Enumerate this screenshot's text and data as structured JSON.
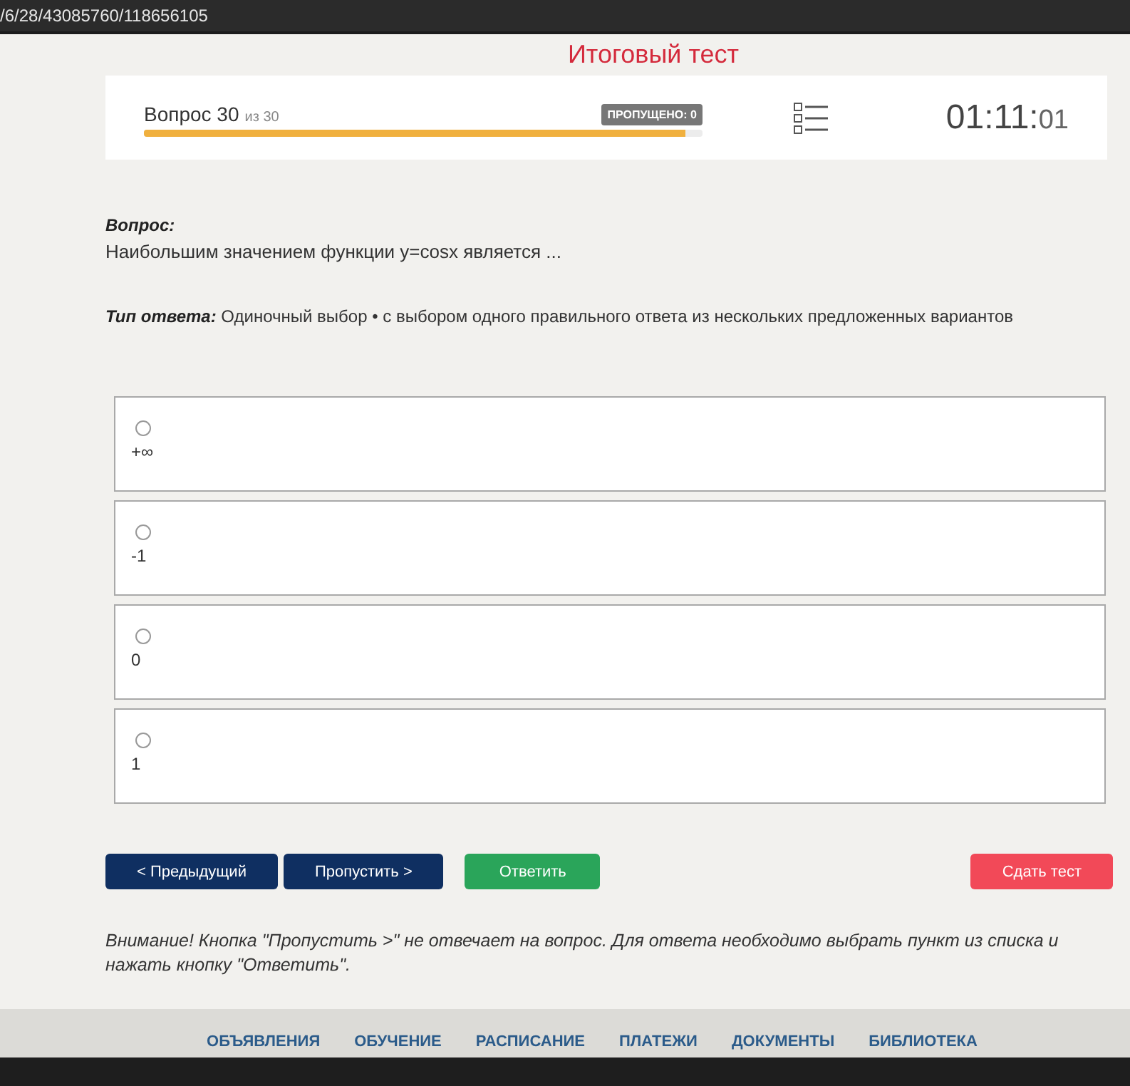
{
  "address_bar": {
    "url": "/6/28/43085760/118656105"
  },
  "title": "Итоговый тест",
  "progress_card": {
    "question_label": "Вопрос 30",
    "question_total": "из 30",
    "skipped_badge": "ПРОПУЩЕНО: 0",
    "level": 0.97,
    "timer_main": "01:11:",
    "timer_seconds": "01"
  },
  "question": {
    "heading": "Вопрос:",
    "text": "Наибольшим значением функции y=cosx является ..."
  },
  "answer_type": {
    "label": "Тип ответа:",
    "text": "Одиночный выбор • с выбором одного правильного ответа из нескольких предложенных вариантов"
  },
  "options": [
    {
      "label": "+∞",
      "selected": false
    },
    {
      "label": "-1",
      "selected": false
    },
    {
      "label": "0",
      "selected": false
    },
    {
      "label": "1",
      "selected": false
    }
  ],
  "buttons": [
    {
      "label": "< Предыдущий",
      "kind": "nav"
    },
    {
      "label": "Пропустить >",
      "kind": "nav"
    },
    {
      "label": "Ответить",
      "kind": "submit"
    },
    {
      "label": "Сдать тест",
      "kind": "finish"
    }
  ],
  "note": "Внимание! Кнопка \"Пропустить >\" не отвечает на вопрос. Для ответа необходимо выбрать пункт из списка и нажать кнопку \"Ответить\".",
  "footer_nav": [
    "ОБЪЯВЛЕНИЯ",
    "ОБУЧЕНИЕ",
    "РАСПИСАНИЕ",
    "ПЛАТЕЖИ",
    "ДОКУМЕНТЫ",
    "БИБЛИОТЕКА"
  ]
}
